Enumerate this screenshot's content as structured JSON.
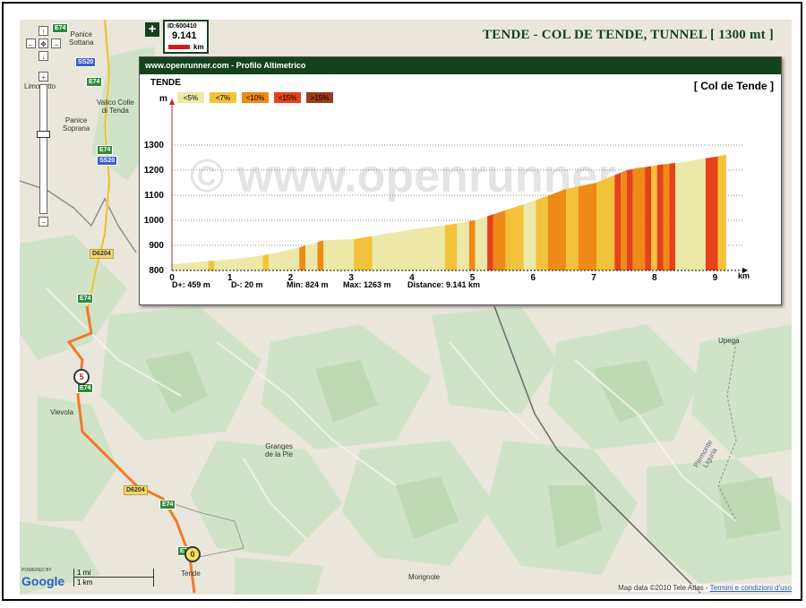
{
  "title": "TENDE  -  COL DE TENDE, TUNNEL  [ 1300 mt ]",
  "infobox": {
    "id_label": "ID:600410",
    "distance": "9.141",
    "unit": "km"
  },
  "profile": {
    "header": "www.openrunner.com - Profilo Altimetrico",
    "start_label": "TENDE",
    "end_label": "[ Col de Tende ]",
    "y_unit": "m",
    "x_unit": "km",
    "watermark": "© www.openrunner.com",
    "legend": [
      {
        "label": "<5%",
        "color": "#ece9a8"
      },
      {
        "label": "<7%",
        "color": "#f2c23a"
      },
      {
        "label": "<10%",
        "color": "#ee8a16"
      },
      {
        "label": "<15%",
        "color": "#e5411a"
      },
      {
        "label": ">15%",
        "color": "#9b3a1e"
      }
    ],
    "stats": {
      "d_plus": "D+: 459 m",
      "d_minus": "D-: 20 m",
      "min": "Min: 824 m",
      "max": "Max: 1263 m",
      "distance": "Distance: 9.141 km"
    }
  },
  "chart_data": {
    "type": "area",
    "xlabel": "km",
    "ylabel": "m",
    "xlim": [
      0,
      9.141
    ],
    "ylim": [
      800,
      1300
    ],
    "x_ticks": [
      "0",
      "1",
      "2",
      "3",
      "4",
      "5",
      "6",
      "7",
      "8",
      "9"
    ],
    "y_ticks": [
      "800",
      "900",
      "1000",
      "1100",
      "1200",
      "1300"
    ],
    "grid": true,
    "x": [
      0,
      0.5,
      1,
      1.5,
      2,
      2.5,
      3,
      3.5,
      4,
      4.5,
      5,
      5.5,
      6,
      6.5,
      7,
      7.5,
      8,
      8.5,
      9,
      9.141
    ],
    "y": [
      824,
      835,
      845,
      860,
      885,
      920,
      925,
      945,
      965,
      980,
      1000,
      1040,
      1080,
      1125,
      1150,
      1200,
      1220,
      1235,
      1255,
      1263
    ],
    "segments": [
      {
        "x0": 0,
        "x1": 0.6,
        "grade": "<5%"
      },
      {
        "x0": 0.6,
        "x1": 0.7,
        "grade": "<7%"
      },
      {
        "x0": 0.7,
        "x1": 1.5,
        "grade": "<5%"
      },
      {
        "x0": 1.5,
        "x1": 1.6,
        "grade": "<7%"
      },
      {
        "x0": 1.6,
        "x1": 2.1,
        "grade": "<5%"
      },
      {
        "x0": 2.1,
        "x1": 2.2,
        "grade": "<10%"
      },
      {
        "x0": 2.2,
        "x1": 2.4,
        "grade": "<5%"
      },
      {
        "x0": 2.4,
        "x1": 2.5,
        "grade": "<10%"
      },
      {
        "x0": 2.5,
        "x1": 3.0,
        "grade": "<5%"
      },
      {
        "x0": 3.0,
        "x1": 3.3,
        "grade": "<7%"
      },
      {
        "x0": 3.3,
        "x1": 4.5,
        "grade": "<5%"
      },
      {
        "x0": 4.5,
        "x1": 4.7,
        "grade": "<7%"
      },
      {
        "x0": 4.7,
        "x1": 4.9,
        "grade": "<5%"
      },
      {
        "x0": 4.9,
        "x1": 5.0,
        "grade": "<10%"
      },
      {
        "x0": 5.0,
        "x1": 5.2,
        "grade": "<5%"
      },
      {
        "x0": 5.2,
        "x1": 5.3,
        "grade": "<15%"
      },
      {
        "x0": 5.3,
        "x1": 5.5,
        "grade": "<10%"
      },
      {
        "x0": 5.5,
        "x1": 5.8,
        "grade": "<7%"
      },
      {
        "x0": 5.8,
        "x1": 6.0,
        "grade": "<5%"
      },
      {
        "x0": 6.0,
        "x1": 6.2,
        "grade": "<7%"
      },
      {
        "x0": 6.2,
        "x1": 6.5,
        "grade": "<10%"
      },
      {
        "x0": 6.5,
        "x1": 6.7,
        "grade": "<7%"
      },
      {
        "x0": 6.7,
        "x1": 7.0,
        "grade": "<10%"
      },
      {
        "x0": 7.0,
        "x1": 7.3,
        "grade": "<7%"
      },
      {
        "x0": 7.3,
        "x1": 7.4,
        "grade": "<15%"
      },
      {
        "x0": 7.4,
        "x1": 7.5,
        "grade": "<10%"
      },
      {
        "x0": 7.5,
        "x1": 7.6,
        "grade": "<15%"
      },
      {
        "x0": 7.6,
        "x1": 7.8,
        "grade": "<10%"
      },
      {
        "x0": 7.8,
        "x1": 7.9,
        "grade": "<15%"
      },
      {
        "x0": 7.9,
        "x1": 8.0,
        "grade": "<7%"
      },
      {
        "x0": 8.0,
        "x1": 8.1,
        "grade": "<15%"
      },
      {
        "x0": 8.1,
        "x1": 8.2,
        "grade": "<10%"
      },
      {
        "x0": 8.2,
        "x1": 8.3,
        "grade": "<15%"
      },
      {
        "x0": 8.3,
        "x1": 8.8,
        "grade": "<5%"
      },
      {
        "x0": 8.8,
        "x1": 9.0,
        "grade": "<15%"
      },
      {
        "x0": 9.0,
        "x1": 9.141,
        "grade": "<7%"
      }
    ]
  },
  "map": {
    "labels": {
      "panice_sottana": "Panice\nSottana",
      "limonetto": "Limonetto",
      "valico": "Valico Colle\ndi Tenda",
      "panice_soprana": "Panice\nSoprana",
      "vievola": "Vievola",
      "granges": "Granges\nde la Pie",
      "upega": "Upega",
      "piemonte": "Piemonte\nLiguria",
      "morignole": "Morignole",
      "tende": "Tende"
    },
    "shields": {
      "e74": "E74",
      "ss20": "SS20",
      "d6204": "D6204"
    },
    "markers": {
      "five": "5",
      "zero": "0"
    },
    "scale": {
      "mi": "1 mi",
      "km": "1 km"
    },
    "powered": "POWERED BY",
    "google": "Google",
    "attribution": "Map data ©2010 Tele Atlas - ",
    "terms": "Termini e condizioni d'uso",
    "controls": {
      "up": "↑",
      "left": "←",
      "center": "✥",
      "right": "→",
      "down": "↓",
      "zoom_in": "+",
      "zoom_out": "−"
    }
  },
  "colors": {
    "accent": "#14421e",
    "route": "#ef7a2a"
  }
}
